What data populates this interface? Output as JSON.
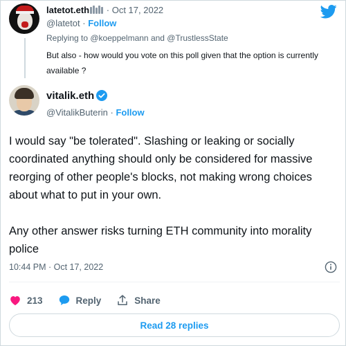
{
  "reply_tweet": {
    "display_name": "latetot.eth",
    "dot": "·",
    "date": "Oct 17, 2022",
    "handle": "@latetot",
    "follow_label": "Follow",
    "replying_to": "Replying to @koeppelmann and @TrustlessState",
    "text": "But also - how would you vote on this poll given that the option is currently available ?"
  },
  "main_tweet": {
    "display_name": "vitalik.eth",
    "handle": "@VitalikButerin",
    "dot": "·",
    "follow_label": "Follow",
    "paragraph_1": "I would say \"be tolerated\". Slashing or leaking or socially coordinated anything should only be considered for massive reorging of other people's blocks, not making wrong choices about what to put in your own.",
    "paragraph_2": "Any other answer risks turning ETH community into morality police",
    "timestamp": "10:44 PM · Oct 17, 2022",
    "actions": {
      "like_count": "213",
      "reply_label": "Reply",
      "share_label": "Share"
    },
    "read_replies_label": "Read 28 replies"
  },
  "icons": {
    "brand": "twitter-bird-icon",
    "verified": "verified-badge-icon",
    "info": "info-icon",
    "like": "heart-icon",
    "reply": "speech-bubble-icon",
    "share": "share-upload-icon"
  },
  "colors": {
    "accent": "#1d9bf0",
    "like": "#f91880",
    "text": "#0f1419",
    "muted": "#536471",
    "border": "#cfd9de"
  }
}
